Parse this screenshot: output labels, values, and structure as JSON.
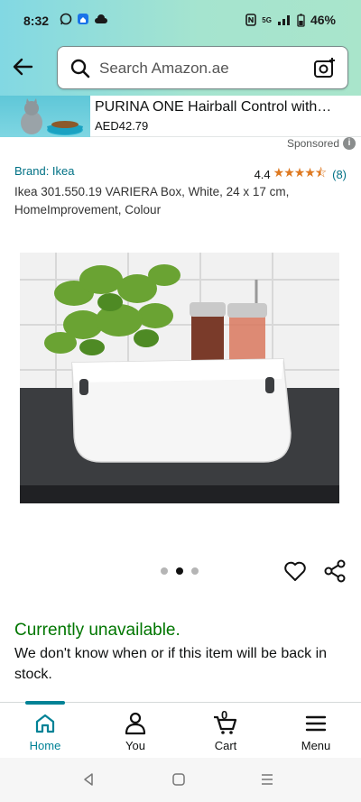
{
  "status_bar": {
    "time": "8:32",
    "battery": "46%",
    "network": "5G"
  },
  "search": {
    "placeholder": "Search Amazon.ae"
  },
  "ad_banner": {
    "title": "PURINA ONE Hairball Control with…",
    "price": "AED42.79"
  },
  "sponsored_label": "Sponsored",
  "product": {
    "brand": "Brand: Ikea",
    "rating_value": "4.4",
    "stars": "★★★★⯪",
    "rating_count": "(8)",
    "title": "Ikea 301.550.19 VARIERA Box, White, 24 x 17 cm, HomeImprovement, Colour",
    "image_count": 3,
    "active_image_index": 1,
    "availability": "Currently unavailable.",
    "availability_note": "We don't know when or if this item will be back in stock."
  },
  "bottom_nav": {
    "items": [
      {
        "label": "Home",
        "icon": "home-icon",
        "active": true
      },
      {
        "label": "You",
        "icon": "person-icon",
        "active": false
      },
      {
        "label": "Cart",
        "icon": "cart-icon",
        "active": false,
        "badge": "0"
      },
      {
        "label": "Menu",
        "icon": "menu-icon",
        "active": false
      }
    ]
  },
  "colors": {
    "link": "#007185",
    "available_green": "#007600",
    "star": "#de7921",
    "active_nav": "#008296"
  }
}
